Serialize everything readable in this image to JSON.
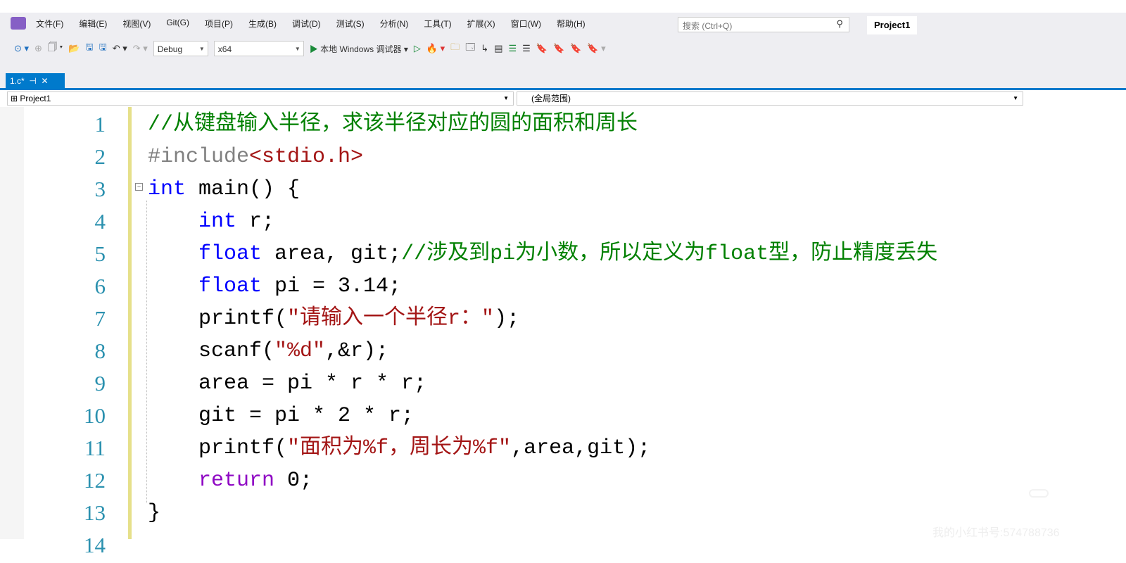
{
  "menu": [
    "文件(F)",
    "编辑(E)",
    "视图(V)",
    "Git(G)",
    "项目(P)",
    "生成(B)",
    "调试(D)",
    "测试(S)",
    "分析(N)",
    "工具(T)",
    "扩展(X)",
    "窗口(W)",
    "帮助(H)"
  ],
  "search": {
    "placeholder": "搜索 (Ctrl+Q)"
  },
  "project_title": "Project1",
  "toolbar": {
    "config": "Debug",
    "platform": "x64",
    "run_label": "本地 Windows 调试器"
  },
  "tab": {
    "label": "1.c*",
    "pin": "⊣",
    "close": "✕"
  },
  "nav": {
    "project": "Project1",
    "scope": "(全局范围)"
  },
  "lines": [
    {
      "n": "1",
      "t": [
        [
          "c",
          "//从键盘输入半径，求该半径对应的圆的面积和周长"
        ]
      ]
    },
    {
      "n": "2",
      "t": [
        [
          "pp",
          "#include"
        ],
        [
          "s",
          "<stdio.h>"
        ]
      ]
    },
    {
      "n": "3",
      "t": [
        [
          "k",
          "int"
        ],
        [
          "n",
          " main() {"
        ]
      ]
    },
    {
      "n": "4",
      "t": [
        [
          "n",
          "    "
        ],
        [
          "k",
          "int"
        ],
        [
          "n",
          " r;"
        ]
      ]
    },
    {
      "n": "5",
      "t": [
        [
          "n",
          "    "
        ],
        [
          "k",
          "float"
        ],
        [
          "n",
          " area, git;"
        ],
        [
          "c",
          "//涉及到pi为小数，所以定义为float型，防止精度丢失"
        ]
      ]
    },
    {
      "n": "6",
      "t": [
        [
          "n",
          "    "
        ],
        [
          "k",
          "float"
        ],
        [
          "n",
          " pi = 3.14;"
        ]
      ]
    },
    {
      "n": "7",
      "t": [
        [
          "n",
          "    printf("
        ],
        [
          "s",
          "\"请输入一个半径r：\""
        ],
        [
          "n",
          ");"
        ]
      ]
    },
    {
      "n": "8",
      "t": [
        [
          "n",
          "    scanf("
        ],
        [
          "s",
          "\"%d\""
        ],
        [
          "n",
          ",&r);"
        ]
      ]
    },
    {
      "n": "9",
      "t": [
        [
          "n",
          "    area = pi * r * r;"
        ]
      ]
    },
    {
      "n": "10",
      "t": [
        [
          "n",
          "    git = pi * 2 * r;"
        ]
      ]
    },
    {
      "n": "11",
      "t": [
        [
          "n",
          "    printf("
        ],
        [
          "s",
          "\"面积为%f，周长为%f\""
        ],
        [
          "n",
          ",area,git);"
        ]
      ]
    },
    {
      "n": "12",
      "t": [
        [
          "n",
          "    "
        ],
        [
          "p",
          "return"
        ],
        [
          "n",
          " 0;"
        ]
      ]
    },
    {
      "n": "13",
      "t": [
        [
          "n",
          "}"
        ]
      ]
    },
    {
      "n": "14",
      "t": []
    }
  ],
  "watermark": {
    "logo": "小红书",
    "id": "我的小红书号:574788736"
  }
}
